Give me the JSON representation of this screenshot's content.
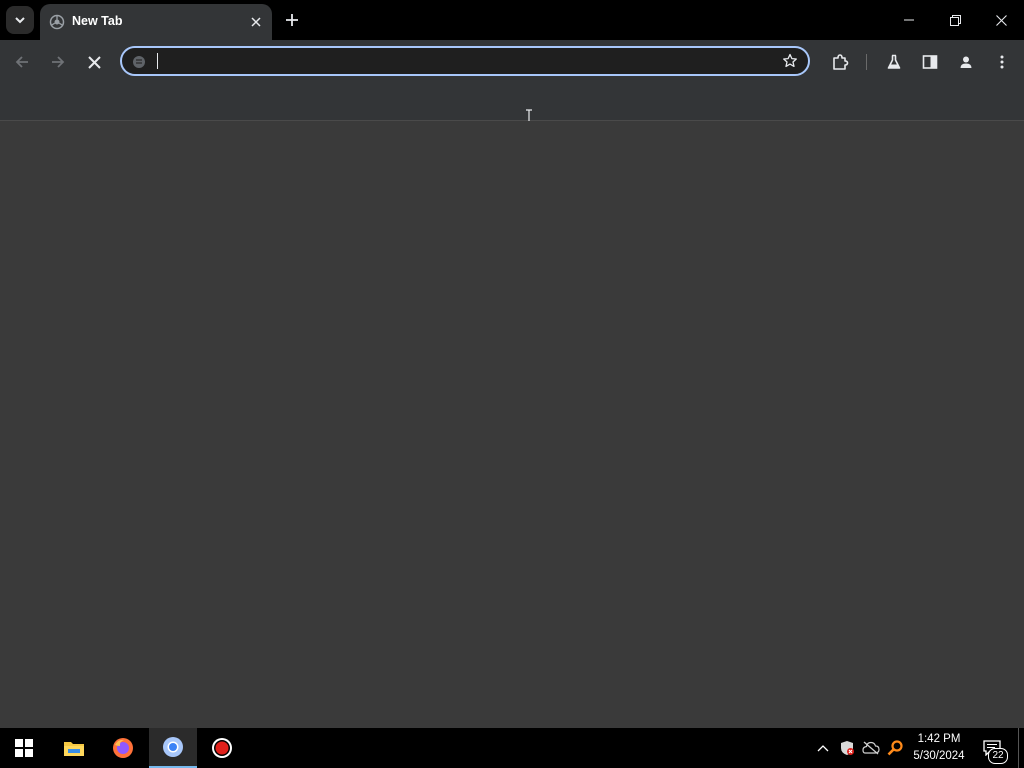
{
  "browser": {
    "tab": {
      "title": "New Tab",
      "favicon": "chrome-new-tab-icon"
    },
    "buttons": {
      "tab_search": "chevron-down-icon",
      "close_tab": "close-icon",
      "new_tab": "plus-icon",
      "minimize": "minimize-icon",
      "restore": "restore-icon",
      "close_window": "close-icon"
    },
    "toolbar": {
      "back": "back-arrow-icon",
      "forward": "forward-arrow-icon",
      "stop": "stop-x-icon",
      "extensions": "puzzle-icon",
      "labs": "flask-icon",
      "side_panel": "side-panel-icon",
      "profile": "profile-icon",
      "menu": "kebab-menu-icon"
    },
    "omnibox": {
      "value": "",
      "placeholder": "",
      "bookmark": "star-icon"
    }
  },
  "taskbar": {
    "apps": [
      {
        "name": "Start",
        "icon": "windows-start-icon"
      },
      {
        "name": "File Explorer",
        "icon": "folder-icon"
      },
      {
        "name": "Firefox",
        "icon": "firefox-icon"
      },
      {
        "name": "Chrome",
        "icon": "chrome-icon",
        "active": true
      },
      {
        "name": "Recorder",
        "icon": "record-icon"
      }
    ],
    "tray": {
      "icons": [
        "chevron-up-icon",
        "security-shield-icon",
        "network-disconnected-icon",
        "search-app-icon"
      ],
      "time": "1:42 PM",
      "date": "5/30/2024",
      "notifications": "22"
    }
  },
  "colors": {
    "accent": "#a8c7fa",
    "tab_bg": "#333537",
    "titlebar": "#000000",
    "page_bg": "#3a3a3a"
  }
}
